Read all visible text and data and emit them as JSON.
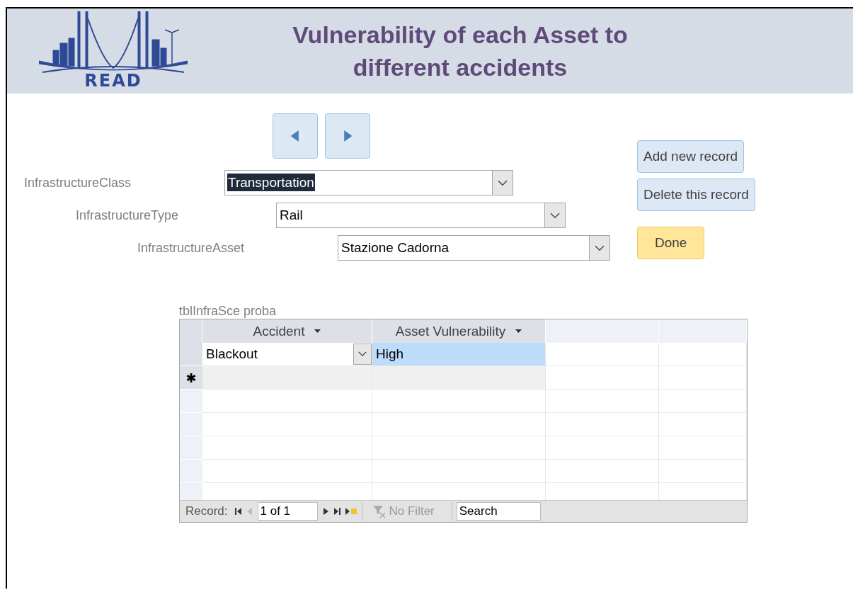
{
  "header": {
    "logo_text": "READ",
    "title": "Vulnerability of each Asset to different accidents"
  },
  "fields": [
    {
      "label": "InfrastructureClass",
      "value": "Transportation",
      "highlighted": true
    },
    {
      "label": "InfrastructureType",
      "value": "Rail",
      "highlighted": false
    },
    {
      "label": "InfrastructureAsset",
      "value": "Stazione Cadorna",
      "highlighted": false
    }
  ],
  "actions": [
    {
      "label": "Add new record",
      "kind": "normal"
    },
    {
      "label": "Delete this record",
      "kind": "normal"
    },
    {
      "label": "Done",
      "kind": "primary"
    }
  ],
  "subform": {
    "caption": "tblInfraSce proba",
    "columns": [
      "Accident",
      "Asset Vulnerability"
    ],
    "rows": [
      {
        "accident": "Blackout",
        "vulnerability": "High",
        "vulnerability_selected": true
      }
    ],
    "new_row_marker": "✱",
    "navigation": {
      "label": "Record:",
      "position": "1 of 1",
      "filter": {
        "label": "No Filter",
        "disabled": true
      },
      "search": "Search"
    }
  }
}
